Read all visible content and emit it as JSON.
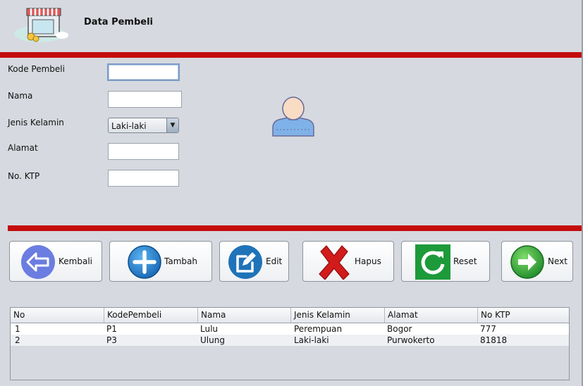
{
  "header": {
    "title": "Data Pembeli",
    "logo_icon": "store-icon"
  },
  "form": {
    "kode_label": "Kode Pembeli",
    "kode_value": "",
    "nama_label": "Nama",
    "nama_value": "",
    "jk_label": "Jenis Kelamin",
    "jk_selected": "Laki-laki",
    "alamat_label": "Alamat",
    "alamat_value": "",
    "ktp_label": "No. KTP",
    "ktp_value": ""
  },
  "avatar_icon": "user-avatar-icon",
  "buttons": {
    "kembali": "Kembali",
    "tambah": "Tambah",
    "edit": "Edit",
    "hapus": "Hapus",
    "reset": "Reset",
    "next": "Next"
  },
  "table": {
    "columns": [
      "No",
      "KodePembeli",
      "Nama",
      "Jenis Kelamin",
      "Alamat",
      "No KTP"
    ],
    "rows": [
      [
        "1",
        "P1",
        "Lulu",
        "Perempuan",
        "Bogor",
        "777"
      ],
      [
        "2",
        "P3",
        "Ulung",
        "Laki-laki",
        "Purwokerto",
        "81818"
      ]
    ]
  },
  "colors": {
    "accent_bar": "#c40d0d",
    "background": "#d6d9df"
  }
}
